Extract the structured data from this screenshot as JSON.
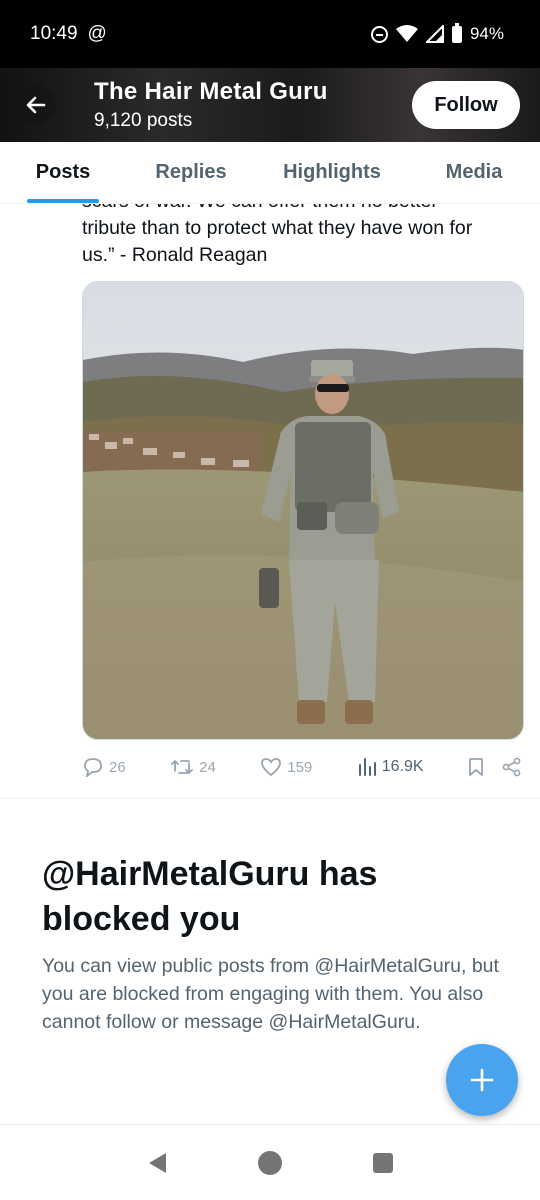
{
  "status_bar": {
    "time": "10:49",
    "at_symbol": "@",
    "battery": "94%"
  },
  "header": {
    "title": "The Hair Metal Guru",
    "post_count": "9,120 posts",
    "follow_label": "Follow"
  },
  "tabs": [
    {
      "label": "Posts",
      "active": true
    },
    {
      "label": "Replies",
      "active": false
    },
    {
      "label": "Highlights",
      "active": false
    },
    {
      "label": "Media",
      "active": false
    }
  ],
  "tweet": {
    "text_partial_line": "scars of war. We can offer them no better",
    "text_line2": "tribute than to protect what they have won for",
    "text_line3": "us.” - Ronald Reagan",
    "replies": "26",
    "reposts": "24",
    "likes": "159",
    "views": "16.9K"
  },
  "blocked": {
    "title": "@HairMetalGuru has blocked you",
    "message": "You can view public posts from @HairMetalGuru, but you are blocked from engaging with them. You also cannot follow or message @HairMetalGuru."
  },
  "colors": {
    "accent": "#1d9bf0",
    "fab": "#4aa3ef",
    "secondary_text": "#536471"
  },
  "icons": [
    "back-arrow-icon",
    "reply-icon",
    "repost-icon",
    "like-icon",
    "views-icon",
    "bookmark-icon",
    "share-icon",
    "plus-icon",
    "nav-back-icon",
    "nav-home-icon",
    "nav-recents-icon"
  ]
}
